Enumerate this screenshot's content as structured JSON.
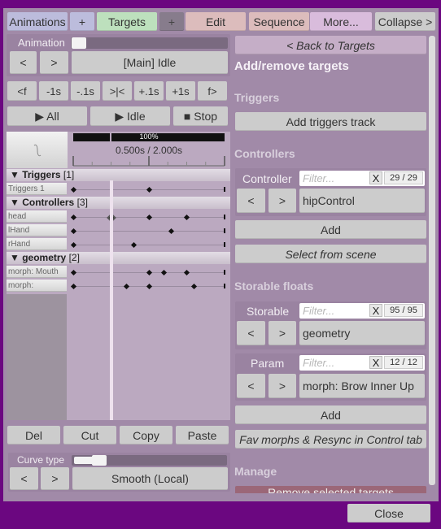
{
  "tabs": [
    {
      "label": "Animations",
      "color": "#bcbcdc"
    },
    {
      "label": "+",
      "color": "#bcbcdc"
    },
    {
      "label": "Targets",
      "color": "#bde0bd"
    },
    {
      "label": "+",
      "color": "#877c8c"
    },
    {
      "label": "Edit",
      "color": "#dcbcbc"
    },
    {
      "label": "Sequence",
      "color": "#dcbcbc"
    },
    {
      "label": "More...",
      "color": "#d9bcdc"
    },
    {
      "label": "Collapse >",
      "color": "#cccccc"
    }
  ],
  "left": {
    "animation_label": "Animation",
    "animation_slider_fraction": 0.0,
    "prev_label": "<",
    "next_label": ">",
    "current_animation": "[Main] Idle",
    "step_buttons": [
      "<f",
      "-1s",
      "-.1s",
      ">|<",
      "+.1s",
      "+1s",
      "f>"
    ],
    "play_all": "▶ All",
    "play_idle": "▶ Idle",
    "stop": "■ Stop",
    "zoom_percent": "100%",
    "time_readout": "0.500s / 2.000s",
    "current_time": 0.5,
    "duration": 2.0,
    "groups": [
      {
        "name": "▼ Triggers",
        "count": "[1]",
        "tracks": [
          {
            "label": "Triggers 1",
            "keys": [
              0,
              1.0
            ],
            "selected": []
          }
        ]
      },
      {
        "name": "▼ Controllers",
        "count": "[3]",
        "tracks": [
          {
            "label": "head",
            "keys": [
              0,
              0.5,
              1.0,
              1.5
            ],
            "selected": [
              0.5
            ]
          },
          {
            "label": "lHand",
            "keys": [
              0,
              1.3
            ],
            "selected": []
          },
          {
            "label": "rHand",
            "keys": [
              0,
              0.8
            ],
            "selected": []
          }
        ]
      },
      {
        "name": "▼ geometry",
        "count": "[2]",
        "tracks": [
          {
            "label": "morph: Mouth",
            "keys": [
              0,
              1.0,
              1.2,
              1.5
            ],
            "selected": []
          },
          {
            "label": "morph:",
            "keys": [
              0,
              0.7,
              1.0,
              1.6
            ],
            "selected": []
          }
        ]
      }
    ],
    "edit_buttons": [
      "Del",
      "Cut",
      "Copy",
      "Paste"
    ],
    "curve_type_label": "Curve type",
    "curve_type_slider_fraction": 0.2,
    "curve_type_value": "Smooth (Local)"
  },
  "right": {
    "back_button": "< Back to Targets",
    "title": "Add/remove targets",
    "triggers_section": "Triggers",
    "add_triggers_track": "Add triggers track",
    "controllers_section": "Controllers",
    "controller_label": "Controller",
    "controller_filter_placeholder": "Filter...",
    "controller_clear": "X",
    "controller_count": "29 / 29",
    "controller_value": "hipControl",
    "controller_add": "Add",
    "select_from_scene": "Select from scene",
    "storable_section": "Storable floats",
    "storable_label": "Storable",
    "storable_filter_placeholder": "Filter...",
    "storable_clear": "X",
    "storable_count": "95 / 95",
    "storable_value": "geometry",
    "param_label": "Param",
    "param_filter_placeholder": "Filter...",
    "param_clear": "X",
    "param_count": "12 / 12",
    "param_value": "morph: Brow Inner Up",
    "param_add": "Add",
    "fav_morphs": "Fav morphs & Resync in Control tab",
    "manage_section": "Manage",
    "remove_selected": "Remove selected targets",
    "nav_prev": "<",
    "nav_next": ">"
  },
  "close_button": "Close",
  "colors": {
    "background": "#6b0780",
    "panel": "#a18aa8",
    "remove_button": "#9b6778"
  }
}
